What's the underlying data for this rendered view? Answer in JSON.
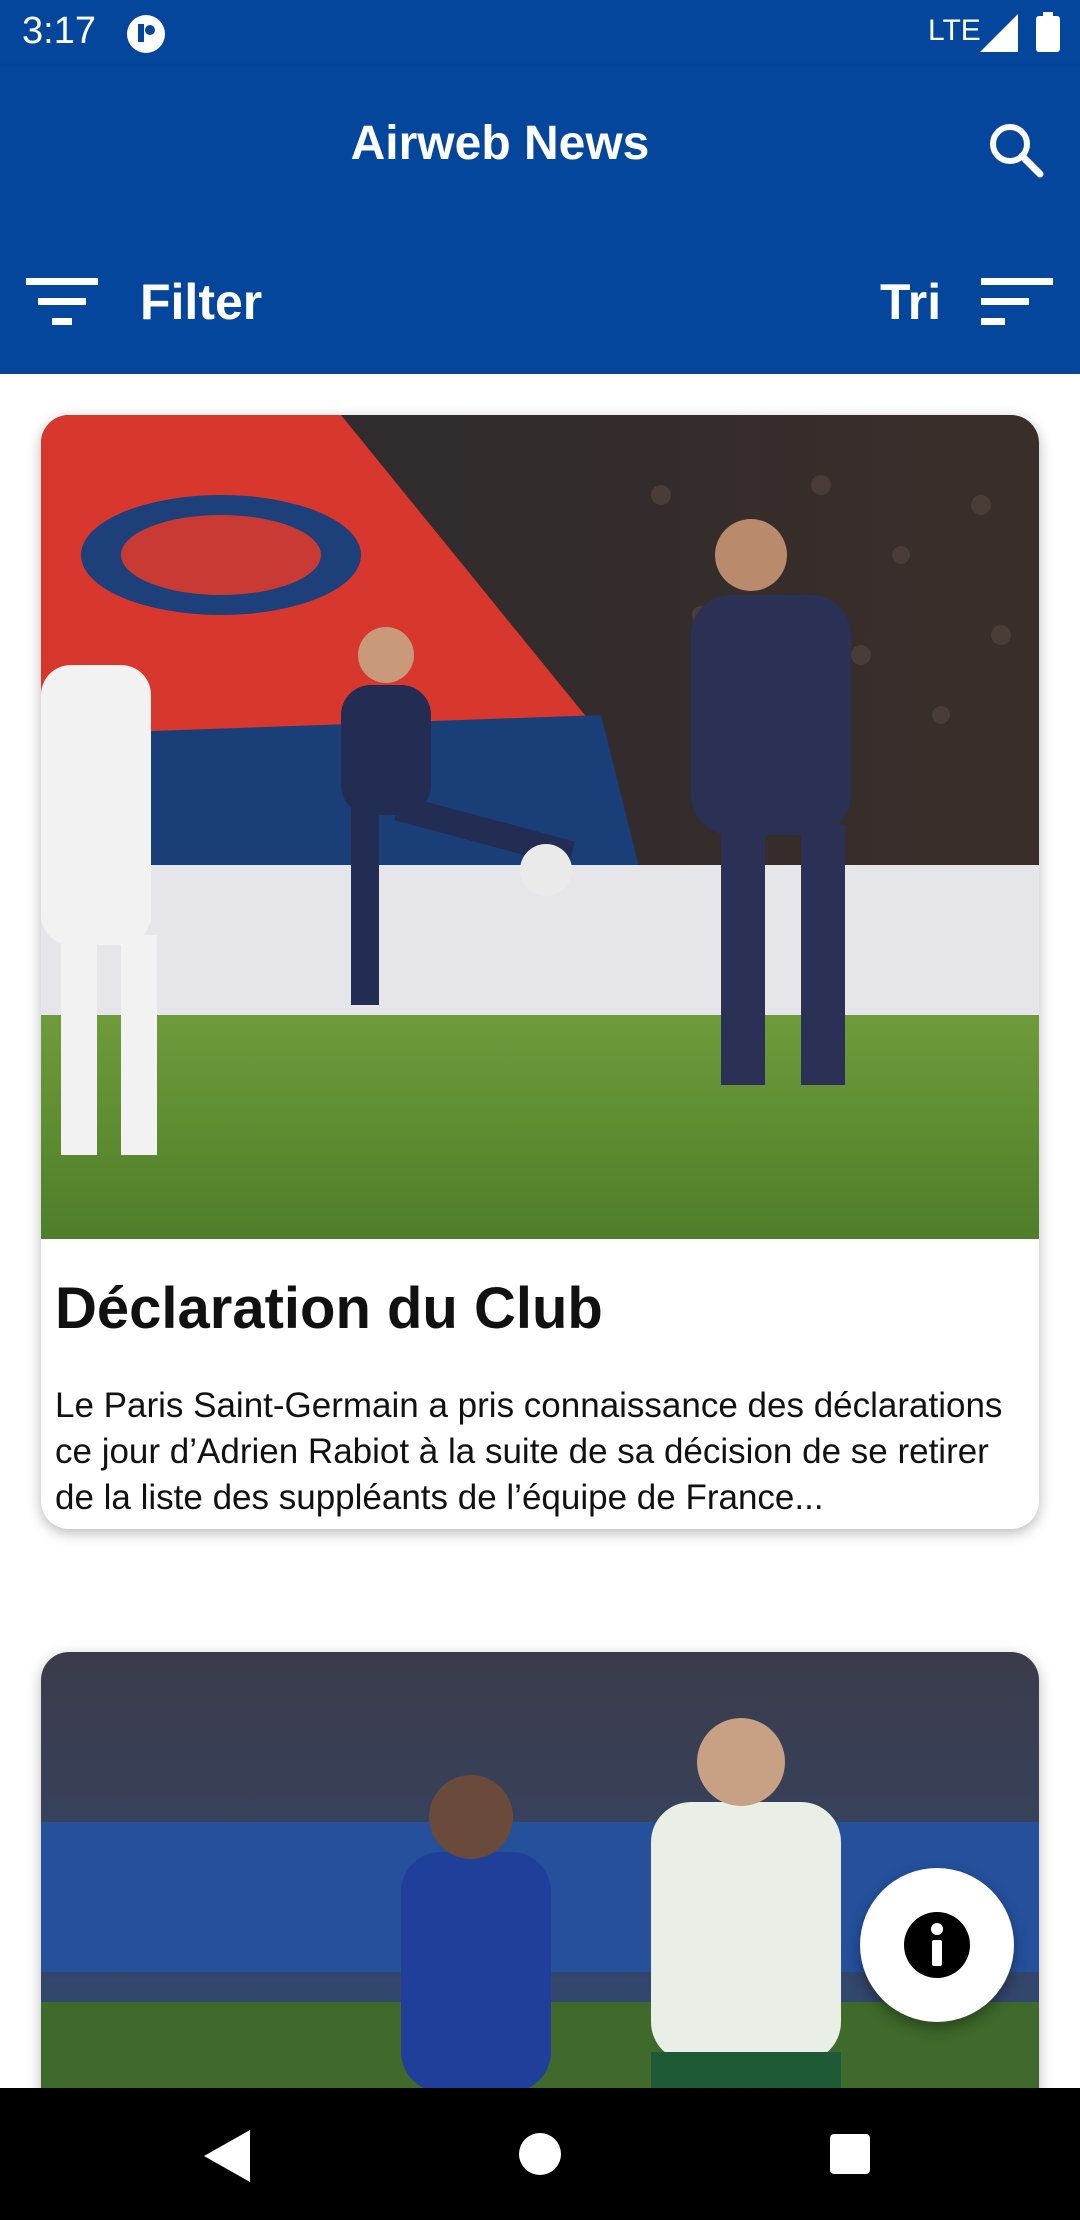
{
  "status_bar": {
    "time": "3:17",
    "network": "LTE",
    "icons": [
      "app-notification-icon",
      "signal-icon",
      "battery-icon"
    ]
  },
  "app_bar": {
    "title": "Airweb News",
    "search_icon": "search-icon",
    "filter_label": "Filter",
    "filter_icon": "filter-icon",
    "sort_label": "Tri",
    "sort_icon": "sort-icon",
    "background_color": "#03469c"
  },
  "articles": [
    {
      "title": "Déclaration du Club",
      "summary": "Le Paris Saint-Germain a pris connaissance des déclarations ce jour d’Adrien Rabiot à la suite de sa décision de se retirer de la liste des suppléants de l’équipe de France...",
      "image": "football-match-photo"
    },
    {
      "title": "",
      "summary": "",
      "image": "football-match-photo"
    }
  ],
  "fab": {
    "icon": "info-icon"
  },
  "nav_bar": {
    "icons": [
      "back-icon",
      "home-icon",
      "recents-icon"
    ]
  }
}
